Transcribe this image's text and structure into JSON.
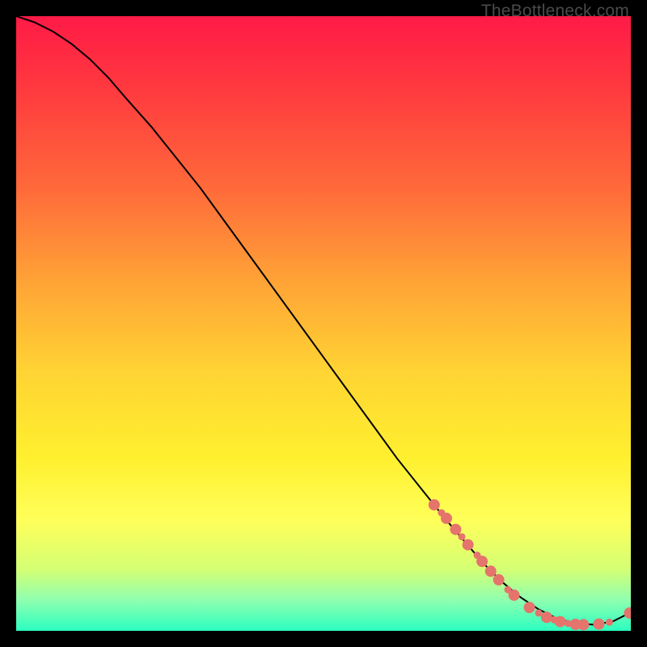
{
  "watermark": "TheBottleneck.com",
  "chart_data": {
    "type": "line",
    "title": "",
    "xlabel": "",
    "ylabel": "",
    "xlim": [
      0,
      100
    ],
    "ylim": [
      0,
      100
    ],
    "grid": false,
    "legend": false,
    "background_gradient": {
      "stops": [
        {
          "pct": 0,
          "color": "#ff1a46"
        },
        {
          "pct": 12,
          "color": "#ff3a3f"
        },
        {
          "pct": 28,
          "color": "#ff6a3a"
        },
        {
          "pct": 44,
          "color": "#ffa636"
        },
        {
          "pct": 58,
          "color": "#ffd433"
        },
        {
          "pct": 72,
          "color": "#fff02f"
        },
        {
          "pct": 82,
          "color": "#ffff5a"
        },
        {
          "pct": 90,
          "color": "#d4ff74"
        },
        {
          "pct": 95,
          "color": "#8fffb0"
        },
        {
          "pct": 100,
          "color": "#2bffc0"
        }
      ]
    },
    "series": [
      {
        "name": "curve",
        "stroke": "#000000",
        "x": [
          0,
          3,
          6,
          9,
          12,
          15,
          18,
          22,
          26,
          30,
          34,
          38,
          42,
          46,
          50,
          54,
          58,
          62,
          66,
          70,
          73,
          76,
          79,
          82,
          85,
          88,
          91,
          94,
          97,
          100
        ],
        "y": [
          100,
          99,
          97.5,
          95.5,
          93,
          90,
          86.5,
          82,
          77,
          72,
          66.5,
          61,
          55.5,
          50,
          44.5,
          39,
          33.5,
          28,
          23,
          18,
          14.5,
          11,
          8,
          5.5,
          3.5,
          2,
          1.2,
          1,
          1.5,
          3
        ]
      }
    ],
    "markers": {
      "color": "#e4746c",
      "radius_major": 7,
      "radius_minor": 4.5,
      "points": [
        {
          "x": 68.0,
          "y": 20.5,
          "r": "major"
        },
        {
          "x": 69.2,
          "y": 19.2,
          "r": "minor"
        },
        {
          "x": 70.0,
          "y": 18.3,
          "r": "major"
        },
        {
          "x": 71.5,
          "y": 16.5,
          "r": "major"
        },
        {
          "x": 72.5,
          "y": 15.3,
          "r": "minor"
        },
        {
          "x": 73.5,
          "y": 14.0,
          "r": "major"
        },
        {
          "x": 75.0,
          "y": 12.3,
          "r": "minor"
        },
        {
          "x": 75.8,
          "y": 11.3,
          "r": "major"
        },
        {
          "x": 77.2,
          "y": 9.7,
          "r": "major"
        },
        {
          "x": 78.5,
          "y": 8.3,
          "r": "major"
        },
        {
          "x": 80.0,
          "y": 6.7,
          "r": "minor"
        },
        {
          "x": 81.0,
          "y": 5.8,
          "r": "major"
        },
        {
          "x": 83.5,
          "y": 3.8,
          "r": "major"
        },
        {
          "x": 85.0,
          "y": 2.9,
          "r": "minor"
        },
        {
          "x": 86.3,
          "y": 2.2,
          "r": "major"
        },
        {
          "x": 87.5,
          "y": 1.8,
          "r": "minor"
        },
        {
          "x": 88.5,
          "y": 1.5,
          "r": "major"
        },
        {
          "x": 89.8,
          "y": 1.2,
          "r": "minor"
        },
        {
          "x": 91.0,
          "y": 1.05,
          "r": "major"
        },
        {
          "x": 92.3,
          "y": 1.0,
          "r": "major"
        },
        {
          "x": 94.8,
          "y": 1.1,
          "r": "major"
        },
        {
          "x": 96.5,
          "y": 1.4,
          "r": "minor"
        },
        {
          "x": 99.8,
          "y": 2.9,
          "r": "major"
        }
      ]
    }
  }
}
